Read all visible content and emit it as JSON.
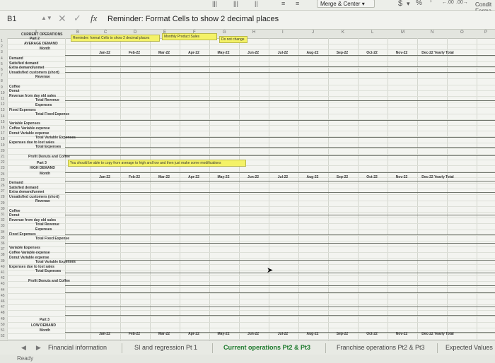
{
  "ribbon": {
    "merge_center": "Merge & Center",
    "currency_symbol": "$",
    "percent_symbol": "%",
    "comma_symbol": "’",
    "conditional_line1": "Condit",
    "conditional_line2": "Forma"
  },
  "formula_bar": {
    "name_box": "B1",
    "fx": "fx",
    "content": "Reminder: Format Cells to show 2 decimal places"
  },
  "sheet": {
    "col_headers": [
      "A",
      "B",
      "C",
      "D",
      "E",
      "F",
      "G",
      "H",
      "I",
      "J",
      "K",
      "L",
      "M",
      "N",
      "O",
      "P"
    ],
    "row_numbers": [
      "1",
      "2",
      "3",
      "4",
      "5",
      "6",
      "7",
      "8",
      "9",
      "10",
      "11",
      "12",
      "13",
      "14",
      "15",
      "16",
      "17",
      "18",
      "19",
      "20",
      "21",
      "22",
      "23",
      "24",
      "25",
      "26",
      "27",
      "28",
      "29",
      "30",
      "31",
      "32",
      "33",
      "34",
      "35",
      "36",
      "37",
      "38",
      "39",
      "40",
      "41",
      "42",
      "43",
      "44",
      "45",
      "46",
      "47",
      "48",
      "49",
      "50",
      "51",
      "52"
    ],
    "section1": {
      "header_top": "CURRENT OPERATIONS",
      "part": "Part 2",
      "title": "AVERAGE DEMAND",
      "month_label": "Month",
      "yellow_notes": [
        "Reminder: format Cells to show 2 decimal places",
        "Monthly Product Sales",
        "Do not change"
      ],
      "months": [
        "Jan-22",
        "Feb-22",
        "Mar-22",
        "Apr-22",
        "May-22",
        "Jun-22",
        "Jul-22",
        "Aug-22",
        "Sep-22",
        "Oct-22",
        "Nov-22",
        "Dec-22 Yearly Total"
      ],
      "rows": [
        "Demand",
        "Satisfied demand",
        "Extra demand/unmet",
        "Unsatisfied customers (short)",
        "Revenue",
        "",
        "Coffee",
        "Donut",
        "Revenue from day old sales",
        "Total Revenue",
        "Expenses",
        "Fixed Expenses",
        "Total Fixed Expense",
        "",
        "Variable Expenses",
        "Coffee Variable expense",
        "Donut Variable expense",
        "Total Variable Expenses",
        "Expenses due to lost sales",
        "Total Expenses",
        "",
        "Profit Donuts and Coffee"
      ]
    },
    "section2": {
      "yellow_note": "You should be able to copy from average to high and low and then just make some modifications",
      "part": "Part 3",
      "title": "HIGH DEMAND",
      "month_label": "Month",
      "months": [
        "Jan-22",
        "Feb-22",
        "Mar-22",
        "Apr-22",
        "May-22",
        "Jun-22",
        "Jul-22",
        "Aug-22",
        "Sep-22",
        "Oct-22",
        "Nov-22",
        "Dec-22 Yearly Total"
      ],
      "rows": [
        "Demand",
        "Satisfied demand",
        "Extra demand/unmet",
        "Unsatisfied customers (short)",
        "Revenue",
        "",
        "Coffee",
        "Donut",
        "Revenue from day old sales",
        "Total Revenue",
        "Expenses",
        "Fixed Expenses",
        "Total Fixed Expense",
        "",
        "Variable Expenses",
        "Coffee Variable expense",
        "Donut Variable expense",
        "Total Variable Expenses",
        "Expenses due to lost sales",
        "Total Expenses",
        "",
        "Profit Donuts and Coffee"
      ]
    },
    "section3": {
      "part": "Part 3",
      "title": "LOW DEMAND",
      "month_label": "Month",
      "months": [
        "Jan-22",
        "Feb-22",
        "Mar-22",
        "Apr-22",
        "May-22",
        "Jun-22",
        "Jul-22",
        "Aug-22",
        "Sep-22",
        "Oct-22",
        "Nov-22",
        "Dec-22 Yearly Total"
      ]
    }
  },
  "tabs": [
    {
      "label": "Financial information",
      "active": false
    },
    {
      "label": "SI and regression Pt 1",
      "active": false
    },
    {
      "label": "Current operations Pt2 & Pt3",
      "active": true
    },
    {
      "label": "Franchise operations Pt2 & Pt3",
      "active": false
    },
    {
      "label": "Expected Values",
      "active": false
    }
  ],
  "status": "Ready",
  "colors": {
    "highlight": "#f4f267",
    "active_tab": "#1c7a2c"
  }
}
